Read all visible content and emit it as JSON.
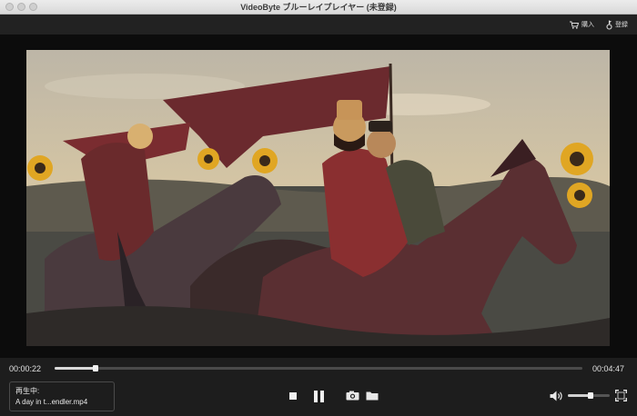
{
  "window": {
    "title": "VideoByte ブルーレイプレイヤー (未登録)"
  },
  "toolbar": {
    "purchase_label": "購入",
    "register_label": "登録",
    "purchase_icon": "cart-icon",
    "register_icon": "key-icon"
  },
  "player": {
    "current_time": "00:00:22",
    "total_time": "00:04:47",
    "progress": 0.077,
    "volume": 0.55
  },
  "now_playing": {
    "label": "再生中:",
    "filename": "A day in t...endler.mp4"
  },
  "controls": {
    "stop_icon": "stop-icon",
    "pause_icon": "pause-icon",
    "snapshot_icon": "camera-icon",
    "folder_icon": "folder-icon",
    "volume_icon": "speaker-icon",
    "fullscreen_icon": "fullscreen-icon"
  }
}
